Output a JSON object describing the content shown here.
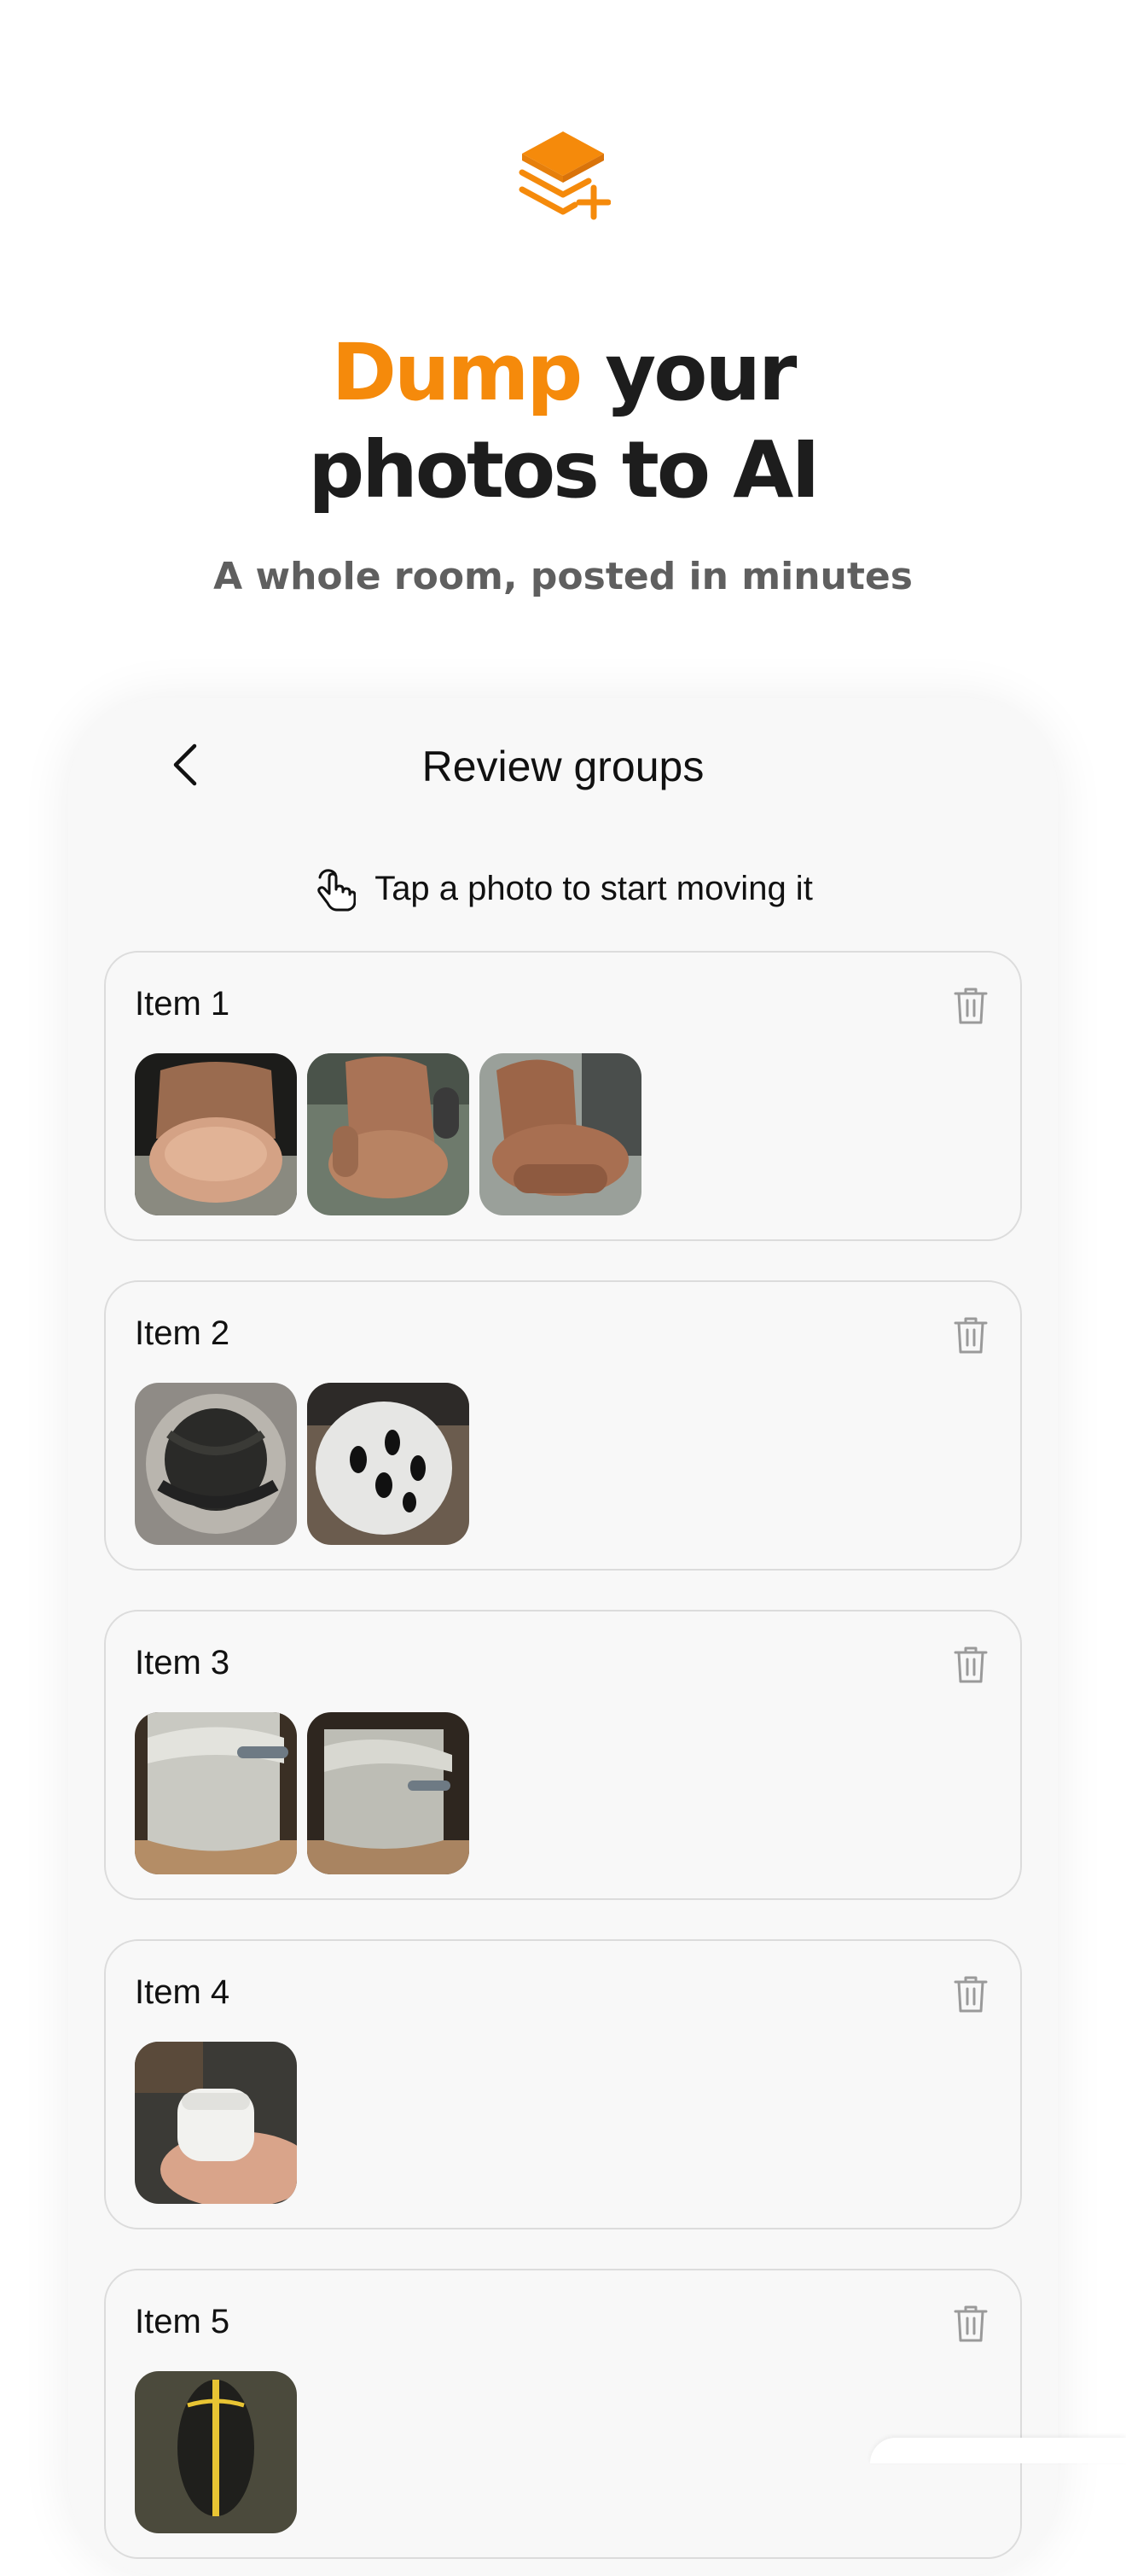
{
  "hero": {
    "logo_icon": "stack-plus-icon",
    "headline_accent": "Dump",
    "headline_rest_line1": "your",
    "headline_line2": "photos to AI",
    "subheadline": "A whole room, posted in minutes",
    "accent_color": "#f58a0b"
  },
  "screen": {
    "title": "Review groups",
    "back_icon": "chevron-left-icon",
    "hint_icon": "tap-hand-icon",
    "hint": "Tap a photo to start moving it"
  },
  "groups": [
    {
      "title": "Item 1",
      "photos": [
        "leather office chair seat",
        "leather office chair side",
        "leather office chair angle"
      ]
    },
    {
      "title": "Item 2",
      "photos": [
        "helmet inside",
        "white bike helmet"
      ]
    },
    {
      "title": "Item 3",
      "photos": [
        "white trash can",
        "white trash can angle"
      ]
    },
    {
      "title": "Item 4",
      "photos": [
        "hand holding earbuds case"
      ]
    },
    {
      "title": "Item 5",
      "photos": [
        "yellow and black object"
      ]
    }
  ]
}
